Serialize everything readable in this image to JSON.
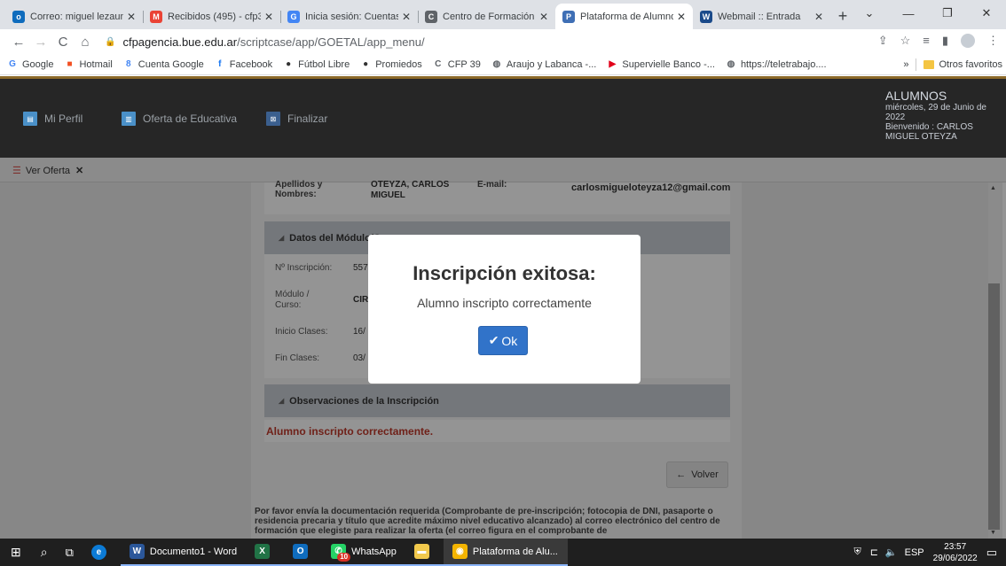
{
  "browser": {
    "tabs": [
      {
        "title": "Correo: miguel lezaun",
        "icon": "outlook-icon",
        "color": "#0f6cbd",
        "glyph": "o"
      },
      {
        "title": "Recibidos (495) - cfp3",
        "icon": "gmail-icon",
        "color": "#ea4335",
        "glyph": "M"
      },
      {
        "title": "Inicia sesión: Cuentas",
        "icon": "google-icon",
        "color": "#4285f4",
        "glyph": "G"
      },
      {
        "title": "Centro de Formación",
        "icon": "cfp-icon",
        "color": "#5f6368",
        "glyph": "C"
      },
      {
        "title": "Plataforma de Alumno",
        "icon": "platform-icon",
        "color": "#3f6fb5",
        "glyph": "P"
      },
      {
        "title": "Webmail :: Entrada",
        "icon": "webmail-icon",
        "color": "#1a4a8a",
        "glyph": "W"
      }
    ],
    "active_tab_index": 4,
    "url_host": "cfpagencia.bue.edu.ar",
    "url_path": "/scriptcase/app/GOETAL/app_menu/",
    "bookmarks": [
      {
        "label": "Google",
        "icon": "google-icon",
        "color": "#4285f4",
        "glyph": "G"
      },
      {
        "label": "Hotmail",
        "icon": "windows-icon",
        "color": "#f25022",
        "glyph": "■"
      },
      {
        "label": "Cuenta Google",
        "icon": "google-account-icon",
        "color": "#4285f4",
        "glyph": "8"
      },
      {
        "label": "Facebook",
        "icon": "facebook-icon",
        "color": "#1877f2",
        "glyph": "f"
      },
      {
        "label": "Fútbol Libre",
        "icon": "soccer-icon",
        "color": "#333333",
        "glyph": "●"
      },
      {
        "label": "Promiedos",
        "icon": "promiedos-icon",
        "color": "#333333",
        "glyph": "●"
      },
      {
        "label": "CFP 39",
        "icon": "cfp-icon",
        "color": "#5f6368",
        "glyph": "C"
      },
      {
        "label": "Araujo y Labanca -...",
        "icon": "globe-icon",
        "color": "#5f6368",
        "glyph": "◍"
      },
      {
        "label": "Supervielle Banco -...",
        "icon": "supervielle-icon",
        "color": "#e2001a",
        "glyph": "▶"
      },
      {
        "label": "https://teletrabajo....",
        "icon": "globe-icon",
        "color": "#5f6368",
        "glyph": "◍"
      }
    ],
    "more_bookmarks": "»",
    "other_favorites": "Otros favoritos"
  },
  "app": {
    "menu": [
      {
        "label": "Mi Perfil",
        "icon": "profile-icon"
      },
      {
        "label": "Oferta de Educativa",
        "icon": "book-icon"
      },
      {
        "label": "Finalizar",
        "icon": "exit-icon"
      }
    ],
    "user": {
      "title": "ALUMNOS",
      "line1": "miércoles, 29 de Junio de",
      "line2": "2022",
      "line3": "Bienvenido : CARLOS",
      "line4": "MIGUEL OTEYZA"
    },
    "open_tab": "Ver Oferta"
  },
  "form": {
    "name_label": "Apellidos y Nombres:",
    "name_value_1": "OTEYZA, CARLOS",
    "name_value_2": "MIGUEL",
    "email_label": "E-mail:",
    "email_value": "carlosmigueloteyza12@gmail.com",
    "section_modulo": "Datos del Módulo/Curso",
    "inscripcion_label": "Nº Inscripción:",
    "inscripcion_value": "557",
    "modulo_label_1": "Módulo /",
    "modulo_label_2": "Curso:",
    "modulo_value": "CIR",
    "inicio_label": "Inicio Clases:",
    "inicio_value": "16/",
    "fin_label": "Fin Clases:",
    "fin_value": "03/",
    "section_obs": "Observaciones de la Inscripción",
    "obs_text": "Alumno inscripto correctamente.",
    "volver_label": "Volver",
    "footer_note": "Por favor envía la documentación requerida (Comprobante de pre-inscripción; fotocopia de DNI, pasaporte o residencia precaria y título que acredite máximo nivel educativo alcanzado) al correo electrónico del centro de formación que elegiste para realizar la oferta (el correo figura en el comprobante de"
  },
  "modal": {
    "title": "Inscripción exitosa:",
    "message": "Alumno inscripto correctamente",
    "ok_label": "Ok"
  },
  "taskbar": {
    "apps": [
      {
        "label": "Documento1 - Word",
        "icon": "word-icon",
        "color": "#2b579a",
        "glyph": "W"
      },
      {
        "label": "",
        "icon": "excel-icon",
        "color": "#217346",
        "glyph": "X"
      },
      {
        "label": "",
        "icon": "outlook-icon",
        "color": "#0f6cbd",
        "glyph": "O"
      },
      {
        "label": "WhatsApp",
        "icon": "whatsapp-icon",
        "color": "#25d366",
        "glyph": "✆",
        "badge": "10"
      },
      {
        "label": "",
        "icon": "file-explorer-icon",
        "color": "#f2c94c",
        "glyph": "▬"
      },
      {
        "label": "Plataforma de Alu...",
        "icon": "chrome-icon",
        "color": "#f4b400",
        "glyph": "◉"
      }
    ],
    "language": "ESP",
    "time": "23:57",
    "date": "29/06/2022"
  }
}
